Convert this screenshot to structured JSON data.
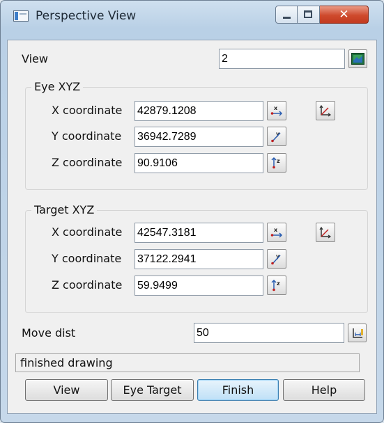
{
  "window": {
    "title": "Perspective View",
    "icons": {
      "app": "window-app-icon",
      "minimize": "minimize-icon",
      "maximize": "maximize-icon",
      "close": "close-icon"
    }
  },
  "view": {
    "label": "View",
    "value": "2",
    "button_icon": "view-picture-icon"
  },
  "eye": {
    "title": "Eye XYZ",
    "x": {
      "label": "X coordinate",
      "value": "42879.1208"
    },
    "y": {
      "label": "Y coordinate",
      "value": "36942.7289"
    },
    "z": {
      "label": "Z coordinate",
      "value": "90.9106"
    },
    "pick_icon": "pick-point-icon"
  },
  "target": {
    "title": "Target XYZ",
    "x": {
      "label": "X coordinate",
      "value": "42547.3181"
    },
    "y": {
      "label": "Y coordinate",
      "value": "37122.2941"
    },
    "z": {
      "label": "Z coordinate",
      "value": "59.9499"
    },
    "pick_icon": "pick-point-icon"
  },
  "move_dist": {
    "label": "Move dist",
    "value": "50",
    "button_icon": "measure-distance-icon"
  },
  "status": "finished drawing",
  "buttons": {
    "view": "View",
    "eye_target": "Eye  Target",
    "finish": "Finish",
    "help": "Help"
  }
}
